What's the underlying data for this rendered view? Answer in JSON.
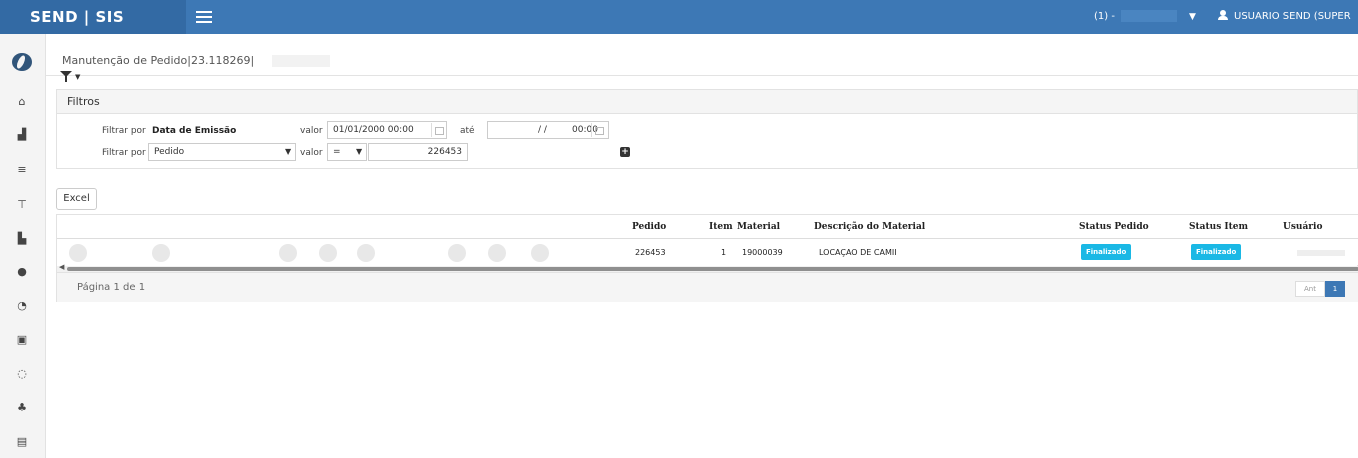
{
  "topbar": {
    "brand": "SEND | SIS",
    "company": "(1) -",
    "user": "USUARIO SEND (SUPER"
  },
  "sidebar": {
    "items": [
      {
        "icon": "home-icon",
        "glyph": "⌂"
      },
      {
        "icon": "chart-icon",
        "glyph": "▟"
      },
      {
        "icon": "list-icon",
        "glyph": "≡"
      },
      {
        "icon": "cart-icon",
        "glyph": "⊤"
      },
      {
        "icon": "thumbs-up-icon",
        "glyph": "▙"
      },
      {
        "icon": "check-circle-icon",
        "glyph": "●"
      },
      {
        "icon": "thumbs-up-outline-icon",
        "glyph": "◔"
      },
      {
        "icon": "money-icon",
        "glyph": "▣"
      },
      {
        "icon": "handshake-icon",
        "glyph": "◌"
      },
      {
        "icon": "users-icon",
        "glyph": "♣"
      },
      {
        "icon": "database-icon",
        "glyph": "▤"
      }
    ]
  },
  "page": {
    "title": "Manutenção de Pedido|23.118269|"
  },
  "filters": {
    "header": "Filtros",
    "row1": {
      "filter_label": "Filtrar por",
      "field": "Data de Emissão",
      "value_label": "valor",
      "date_from": "01/01/2000 00:00",
      "ate_label": "até",
      "date_to": "/ /",
      "time_to": "00:00"
    },
    "row2": {
      "filter_label": "Filtrar por",
      "field": "Pedido",
      "value_label": "valor",
      "operator": "=",
      "value": "226453"
    }
  },
  "toolbar": {
    "excel_label": "Excel"
  },
  "grid": {
    "columns": {
      "pedido": "Pedido",
      "item": "Item",
      "material": "Material",
      "descricao": "Descrição do Material",
      "status_pedido": "Status Pedido",
      "status_item": "Status Item",
      "usuario": "Usuário"
    },
    "row_actions": [
      "view-icon",
      "document-icon",
      "calendar-icon",
      "factory-icon",
      "print-icon",
      "list-icon",
      "clock-icon",
      "history-icon"
    ],
    "rows": [
      {
        "pedido": "226453",
        "item": "1",
        "material": "19000039",
        "descricao": "LOCAÇAO DE CAMII",
        "status_pedido": "Finalizado",
        "status_item": "Finalizado"
      }
    ]
  },
  "pager": {
    "info": "Página 1 de 1",
    "prev": "Ant",
    "current": "1"
  }
}
